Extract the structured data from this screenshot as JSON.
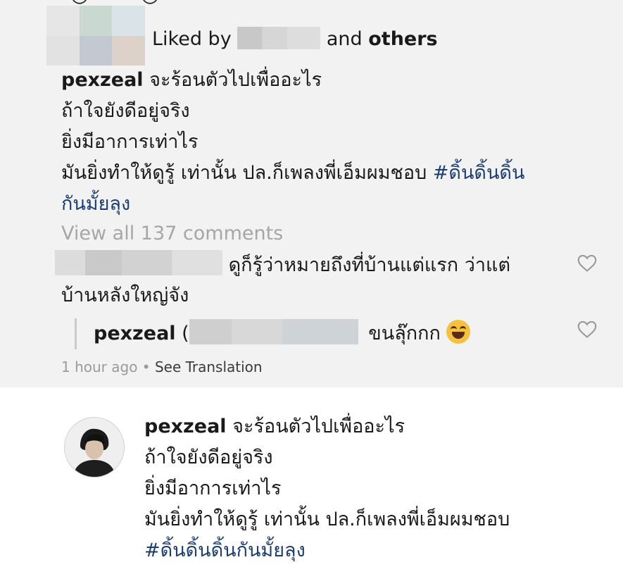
{
  "post": {
    "liked_by_prefix": "Liked by",
    "liked_by_suffix": "and",
    "liked_by_others": "others"
  },
  "caption": {
    "username": "pexzeal",
    "lines": [
      "จะร้อนตัวไปเพื่ออะไร",
      "ถ้าใจยังดีอยู่จริง",
      "ยิ่งมีอาการเท่าไร",
      "มันยิ่งทำให้ดูรู้ เท่านั้น ปล.ก็เพลงพี่เอ็มผมชอบ"
    ],
    "hashtag_part1": "#ดิ้นดิ้นดิ้น",
    "hashtag_part2": "กันมั้ยลุง"
  },
  "comments": {
    "view_all_label": "View all 137 comments",
    "comment1": {
      "text_line1": "ดูก็รู้ว่าหมายถึงที่บ้านแต่แรก ว่าแต่",
      "text_line2": "บ้านหลังใหญ่จัง"
    },
    "reply1": {
      "username": "pexzeal",
      "mention_open": "(",
      "text": "ขนลุ๊กกก",
      "emoji": "face-with-tears-of-joy"
    },
    "meta": {
      "time": "1 hour ago",
      "separator": "•",
      "see_translation": "See Translation"
    }
  },
  "second_card": {
    "username": "pexzeal",
    "lines": [
      "จะร้อนตัวไปเพื่ออะไร",
      "ถ้าใจยังดีอยู่จริง",
      "ยิ่งมีอาการเท่าไร",
      "มันยิ่งทำให้ดูรู้ เท่านั้น ปล.ก็เพลงพี่เอ็มผมชอบ"
    ],
    "hashtag": "#ดิ้นดิ้นดิ้นกันมั้ยลุง"
  },
  "icons": {
    "like_comment": "heart-outline-icon",
    "like_reply": "heart-outline-icon"
  },
  "colors": {
    "hashtag": "#1c3f73",
    "muted": "#a6a6a6",
    "background": "#f2f2f2"
  }
}
